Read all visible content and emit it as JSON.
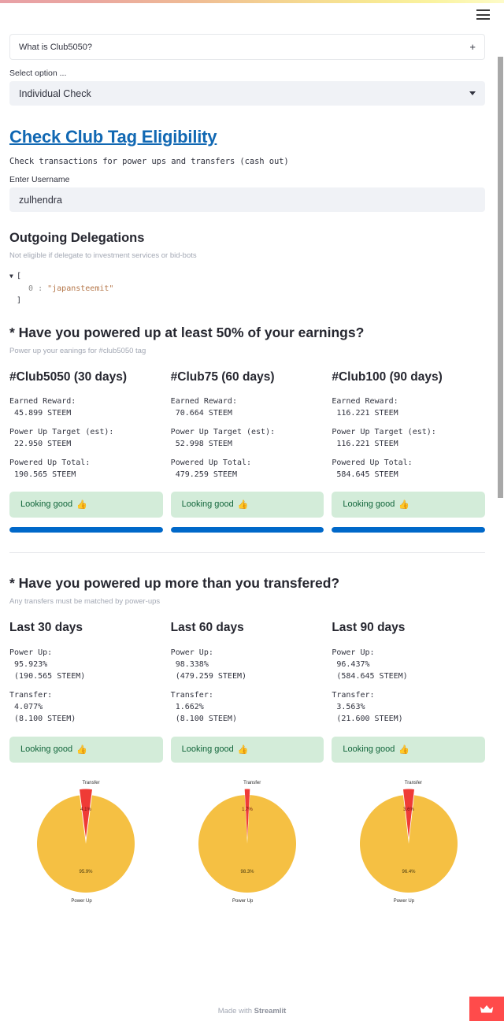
{
  "window": {
    "menu_icon": "hamburger-menu-icon",
    "accent_color": "#0068c9",
    "fab_color": "#ff4b4b",
    "fab_icon": "crown-icon"
  },
  "expander": {
    "label": "What is Club5050?",
    "toggle_glyph": "+"
  },
  "select": {
    "label": "Select option ...",
    "value": "Individual Check",
    "caret_icon": "chevron-down-icon"
  },
  "header": {
    "title": "Check Club Tag Eligibility",
    "subtitle": "Check transactions for power ups and transfers (cash out)"
  },
  "username_field": {
    "label": "Enter Username",
    "value": "zulhendra"
  },
  "delegations": {
    "title": "Outgoing Delegations",
    "caption": "Not eligible if delegate to investment services or bid-bots",
    "open_bracket": "[",
    "close_bracket": "]",
    "entries": [
      {
        "index": "0",
        "sep": ":",
        "value": "\"japansteemit\""
      }
    ]
  },
  "powerup_section": {
    "heading": "* Have you powered up at least 50% of your earnings?",
    "caption": "Power up your eanings for #club5050 tag",
    "columns": [
      {
        "title": "#Club5050 (30 days)",
        "earned_label": "Earned Reward:",
        "earned_value": " 45.899 STEEM",
        "target_label": "Power Up Target (est):",
        "target_value": " 22.950 STEEM",
        "total_label": "Powered Up Total:",
        "total_value": " 190.565 STEEM",
        "status": "Looking good",
        "status_emoji": "👍",
        "progress_pct": 100
      },
      {
        "title": "#Club75 (60 days)",
        "earned_label": "Earned Reward:",
        "earned_value": " 70.664 STEEM",
        "target_label": "Power Up Target (est):",
        "target_value": " 52.998 STEEM",
        "total_label": "Powered Up Total:",
        "total_value": " 479.259 STEEM",
        "status": "Looking good",
        "status_emoji": "👍",
        "progress_pct": 100
      },
      {
        "title": "#Club100 (90 days)",
        "earned_label": "Earned Reward:",
        "earned_value": " 116.221 STEEM",
        "target_label": "Power Up Target (est):",
        "target_value": " 116.221 STEEM",
        "total_label": "Powered Up Total:",
        "total_value": " 584.645 STEEM",
        "status": "Looking good",
        "status_emoji": "👍",
        "progress_pct": 100
      }
    ]
  },
  "transfer_section": {
    "heading": "* Have you powered up more than you transfered?",
    "caption": "Any transfers must be matched by power-ups",
    "columns": [
      {
        "title": "Last 30 days",
        "powerup_label": "Power Up:",
        "powerup_pct": " 95.923%",
        "powerup_amt": " (190.565 STEEM)",
        "transfer_label": "Transfer:",
        "transfer_pct": " 4.077%",
        "transfer_amt": " (8.100 STEEM)",
        "status": "Looking good",
        "status_emoji": "👍"
      },
      {
        "title": "Last 60 days",
        "powerup_label": "Power Up:",
        "powerup_pct": " 98.338%",
        "powerup_amt": " (479.259 STEEM)",
        "transfer_label": "Transfer:",
        "transfer_pct": " 1.662%",
        "transfer_amt": " (8.100 STEEM)",
        "status": "Looking good",
        "status_emoji": "👍"
      },
      {
        "title": "Last 90 days",
        "powerup_label": "Power Up:",
        "powerup_pct": " 96.437%",
        "powerup_amt": " (584.645 STEEM)",
        "transfer_label": "Transfer:",
        "transfer_pct": " 3.563%",
        "transfer_amt": " (21.600 STEEM)",
        "status": "Looking good",
        "status_emoji": "👍"
      }
    ]
  },
  "chart_data": [
    {
      "type": "pie",
      "title": "",
      "labels": [
        "Power Up",
        "Transfer"
      ],
      "values": [
        95.9,
        4.1
      ],
      "value_labels": [
        "95.9%",
        "4.1%"
      ],
      "colors": [
        "#f5c043",
        "#ef3b36"
      ],
      "explode": [
        0,
        0.12
      ],
      "legend": "none"
    },
    {
      "type": "pie",
      "title": "",
      "labels": [
        "Power Up",
        "Transfer"
      ],
      "values": [
        98.3,
        1.7
      ],
      "value_labels": [
        "98.3%",
        "1.7%"
      ],
      "colors": [
        "#f5c043",
        "#ef3b36"
      ],
      "explode": [
        0,
        0.12
      ],
      "legend": "none"
    },
    {
      "type": "pie",
      "title": "",
      "labels": [
        "Power Up",
        "Transfer"
      ],
      "values": [
        96.4,
        3.6
      ],
      "value_labels": [
        "96.4%",
        "3.6%"
      ],
      "colors": [
        "#f5c043",
        "#ef3b36"
      ],
      "explode": [
        0,
        0.12
      ],
      "legend": "none"
    }
  ],
  "footer": {
    "prefix": "Made with ",
    "brand": "Streamlit"
  }
}
